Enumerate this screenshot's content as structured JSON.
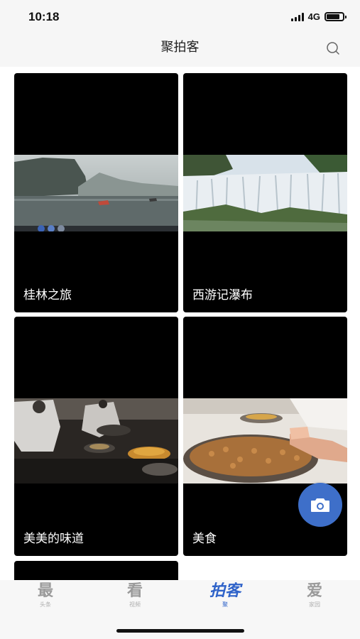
{
  "status_bar": {
    "time": "10:18",
    "network": "4G"
  },
  "nav": {
    "title": "聚拍客",
    "search_icon": "search-icon"
  },
  "cards": [
    {
      "title": "桂林之旅",
      "image": "misty-river-boats"
    },
    {
      "title": "西游记瀑布",
      "image": "waterfall-forest"
    },
    {
      "title": "美美的味道",
      "image": "restaurant-kitchen-cooking"
    },
    {
      "title": "美食",
      "image": "fried-rice-pan"
    }
  ],
  "fab": {
    "icon": "camera-icon"
  },
  "tabs": [
    {
      "icon_text": "最",
      "label": "头条",
      "active": false
    },
    {
      "icon_text": "看",
      "label": "视频",
      "active": false
    },
    {
      "icon_text": "拍客",
      "label": "聚",
      "active": true
    },
    {
      "icon_text": "爱",
      "label": "家园",
      "active": false
    }
  ],
  "colors": {
    "accent": "#2f63c9",
    "fab": "#3e6fc9",
    "card_bg": "#000000",
    "bar_bg": "#f6f6f6"
  }
}
